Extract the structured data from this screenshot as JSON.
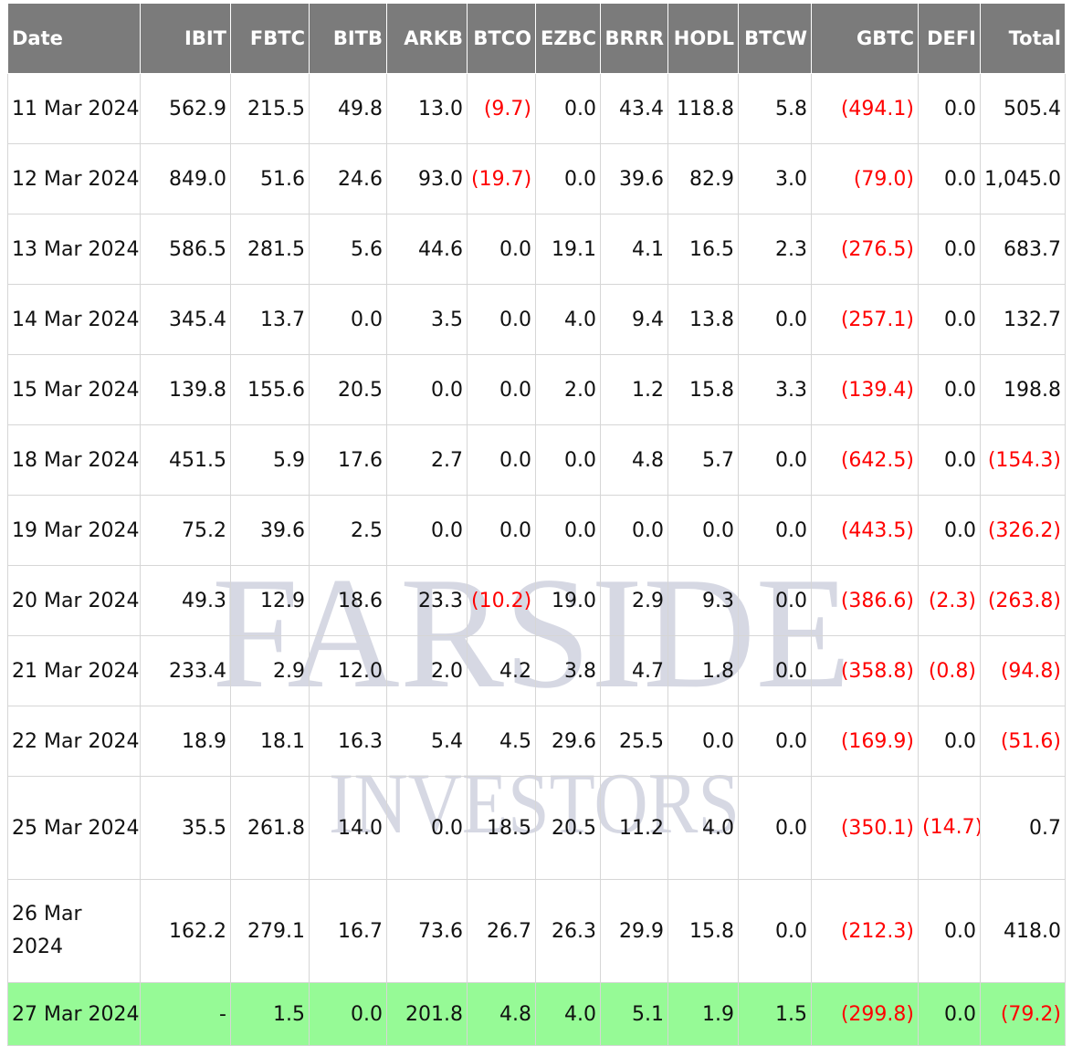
{
  "chart_data": {
    "type": "table",
    "columns": [
      "Date",
      "IBIT",
      "FBTC",
      "BITB",
      "ARKB",
      "BTCO",
      "EZBC",
      "BRRR",
      "HODL",
      "BTCW",
      "GBTC",
      "DEFI",
      "Total"
    ],
    "rows": [
      [
        "11 Mar 2024",
        "562.9",
        "215.5",
        "49.8",
        "13.0",
        "(9.7)",
        "0.0",
        "43.4",
        "118.8",
        "5.8",
        "(494.1)",
        "0.0",
        "505.4"
      ],
      [
        "12 Mar 2024",
        "849.0",
        "51.6",
        "24.6",
        "93.0",
        "(19.7)",
        "0.0",
        "39.6",
        "82.9",
        "3.0",
        "(79.0)",
        "0.0",
        "1,045.0"
      ],
      [
        "13 Mar 2024",
        "586.5",
        "281.5",
        "5.6",
        "44.6",
        "0.0",
        "19.1",
        "4.1",
        "16.5",
        "2.3",
        "(276.5)",
        "0.0",
        "683.7"
      ],
      [
        "14 Mar 2024",
        "345.4",
        "13.7",
        "0.0",
        "3.5",
        "0.0",
        "4.0",
        "9.4",
        "13.8",
        "0.0",
        "(257.1)",
        "0.0",
        "132.7"
      ],
      [
        "15 Mar 2024",
        "139.8",
        "155.6",
        "20.5",
        "0.0",
        "0.0",
        "2.0",
        "1.2",
        "15.8",
        "3.3",
        "(139.4)",
        "0.0",
        "198.8"
      ],
      [
        "18 Mar 2024",
        "451.5",
        "5.9",
        "17.6",
        "2.7",
        "0.0",
        "0.0",
        "4.8",
        "5.7",
        "0.0",
        "(642.5)",
        "0.0",
        "(154.3)"
      ],
      [
        "19 Mar 2024",
        "75.2",
        "39.6",
        "2.5",
        "0.0",
        "0.0",
        "0.0",
        "0.0",
        "0.0",
        "0.0",
        "(443.5)",
        "0.0",
        "(326.2)"
      ],
      [
        "20 Mar 2024",
        "49.3",
        "12.9",
        "18.6",
        "23.3",
        "(10.2)",
        "19.0",
        "2.9",
        "9.3",
        "0.0",
        "(386.6)",
        "(2.3)",
        "(263.8)"
      ],
      [
        "21 Mar 2024",
        "233.4",
        "2.9",
        "12.0",
        "2.0",
        "4.2",
        "3.8",
        "4.7",
        "1.8",
        "0.0",
        "(358.8)",
        "(0.8)",
        "(94.8)"
      ],
      [
        "22 Mar 2024",
        "18.9",
        "18.1",
        "16.3",
        "5.4",
        "4.5",
        "29.6",
        "25.5",
        "0.0",
        "0.0",
        "(169.9)",
        "0.0",
        "(51.6)"
      ],
      [
        "25 Mar 2024",
        "35.5",
        "261.8",
        "14.0",
        "0.0",
        "18.5",
        "20.5",
        "11.2",
        "4.0",
        "0.0",
        "(350.1)",
        "(14.7)",
        "0.7"
      ],
      [
        "26 Mar 2024",
        "162.2",
        "279.1",
        "16.7",
        "73.6",
        "26.7",
        "26.3",
        "29.9",
        "15.8",
        "0.0",
        "(212.3)",
        "0.0",
        "418.0"
      ],
      [
        "27 Mar 2024",
        "-",
        "1.5",
        "0.0",
        "201.8",
        "4.8",
        "4.0",
        "5.1",
        "1.9",
        "1.5",
        "(299.8)",
        "0.0",
        "(79.2)"
      ]
    ],
    "highlight_row_index": 12,
    "negative_color": "#ff0000",
    "header_bg": "#7b7b7b",
    "highlight_bg": "#96fa96"
  },
  "watermark": {
    "line1": "FARSIDE",
    "line2": "INVESTORS",
    "color": "#b4b8cc"
  }
}
